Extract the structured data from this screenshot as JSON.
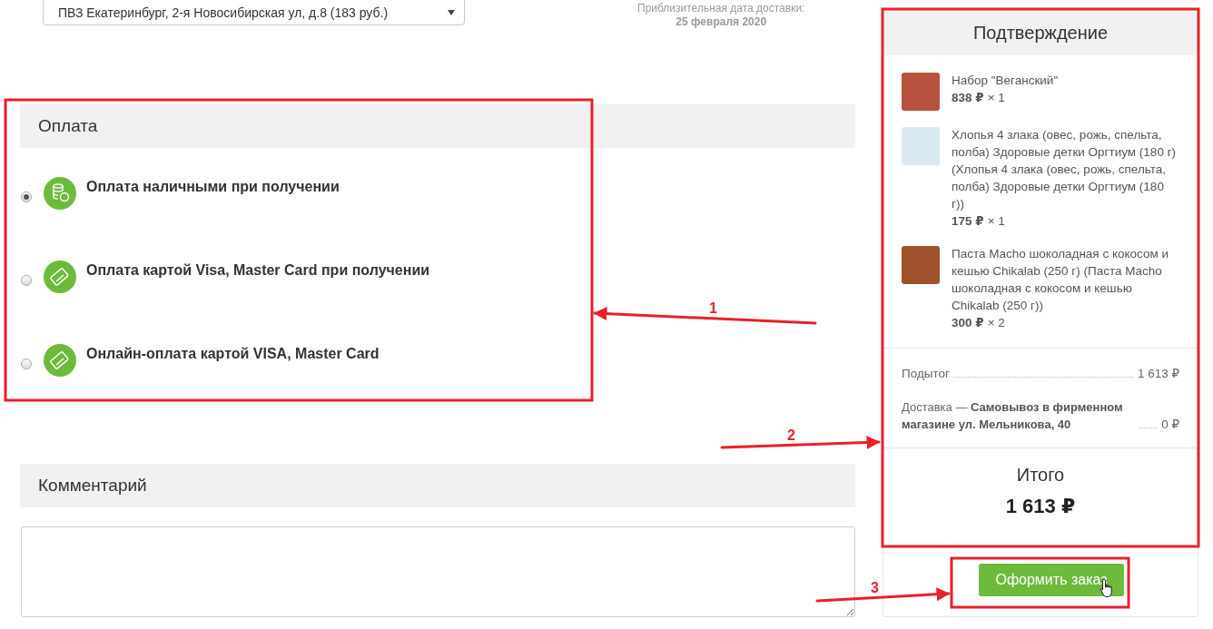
{
  "delivery": {
    "pickup_select": {
      "value": "ПВЗ Екатеринбург, 2-я Новосибирская ул, д.8 (183 руб.)"
    },
    "date_label": "Приблизительная дата доставки:",
    "date": "25 февраля 2020"
  },
  "payment": {
    "title": "Оплата",
    "options": [
      {
        "label": "Оплата наличными при получении",
        "selected": true,
        "kind": "cash"
      },
      {
        "label": "Оплата картой Visa, Master Card при получении",
        "selected": false,
        "kind": "card"
      },
      {
        "label": "Онлайн-оплата картой VISA, Master Card",
        "selected": false,
        "kind": "card"
      }
    ]
  },
  "comment": {
    "title": "Комментарий"
  },
  "confirmation": {
    "title": "Подтверждение",
    "items": [
      {
        "name": "Набор \"Веганский\"",
        "price": "838 ₽",
        "quantity": "× 1",
        "kind": "set"
      },
      {
        "name": "Хлопья 4 злака (овес, рожь, спельта, полба) Здоровые детки Оргтиум (180 г) (Хлопья 4 злака (овес, рожь, спельта, полба) Здоровые детки Оргтиум (180 г))",
        "price": "175 ₽",
        "quantity": "× 1",
        "kind": "box"
      },
      {
        "name": "Паста Macho шоколадная с кокосом и кешью Chikalab (250 г) (Паста Macho шоколадная с кокосом и кешью Chikalab (250 г))",
        "price": "300 ₽",
        "quantity": "× 2",
        "kind": "jar"
      }
    ],
    "subtotal": {
      "label": "Подытог",
      "value": "1 613 ₽"
    },
    "delivery": {
      "text": "Доставка — **Самовывоз в фирменном магазине ул. Мельникова, 40**",
      "value": "0 ₽"
    },
    "total_label": "Итого",
    "total": "1 613 ₽"
  },
  "order_button": {
    "label": "Оформить заказ"
  },
  "annotations": [
    {
      "label": "1"
    },
    {
      "label": "2"
    },
    {
      "label": "3"
    }
  ]
}
